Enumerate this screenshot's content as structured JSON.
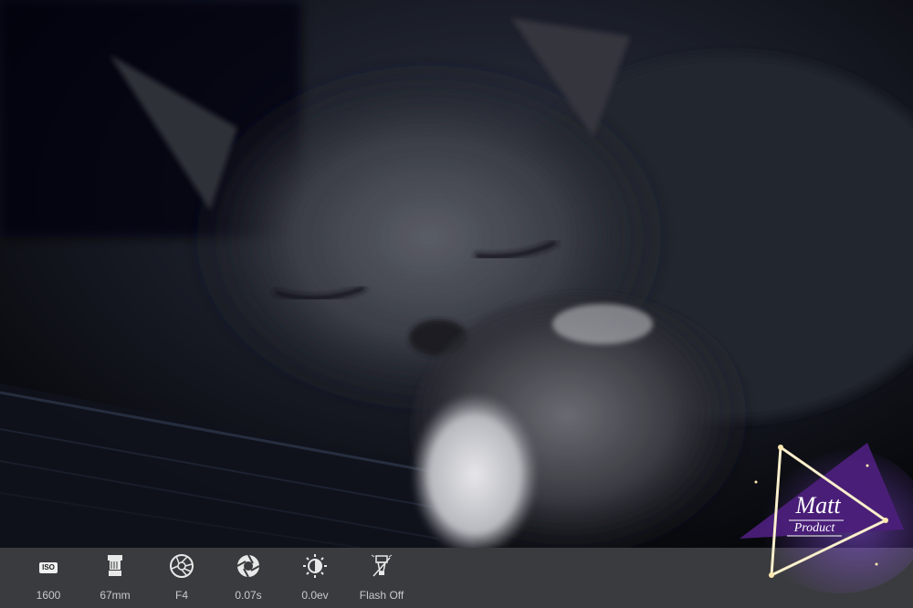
{
  "photo": {
    "subject_icon": "sleeping-cat-photo"
  },
  "exif": {
    "iso": {
      "icon": "iso-icon",
      "badge": "ISO",
      "value": "1600"
    },
    "focal": {
      "icon": "lens-icon",
      "value": "67mm"
    },
    "aperture": {
      "icon": "aperture-icon",
      "value": "F4"
    },
    "shutter": {
      "icon": "shutter-icon",
      "value": "0.07s"
    },
    "exposure": {
      "icon": "exposure-icon",
      "value": "0.0ev"
    },
    "flash": {
      "icon": "flash-icon",
      "value": "Flash Off"
    }
  },
  "watermark": {
    "line1": "Matt",
    "line2": "Product",
    "accent": "#4b1f7a"
  },
  "colors": {
    "bar": "#3a3b3e",
    "text": "#c9cacd"
  }
}
